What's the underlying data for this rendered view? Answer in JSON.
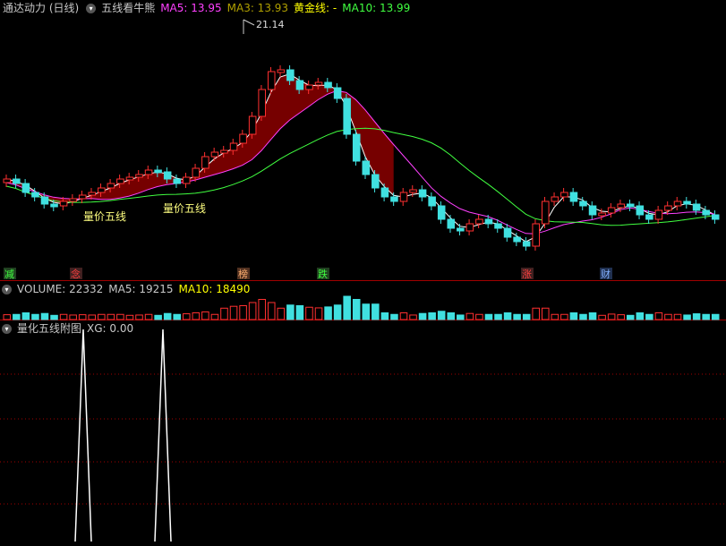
{
  "main_header": {
    "title": "通达动力 (日线)",
    "indicator_name": "五线看牛熊",
    "ma5": "MA5: 13.95",
    "ma3": "MA3: 13.93",
    "gold": "黄金线: -",
    "ma10": "MA10: 13.99",
    "colors": {
      "title": "#c8c8c8",
      "ma5": "#ff40ff",
      "ma3": "#b0a000",
      "gold": "#ffff00",
      "ma10": "#40ff40"
    }
  },
  "high_label": "21.14",
  "signals": [
    "量价五线",
    "量价五线"
  ],
  "event_markers": [
    {
      "text": "减",
      "color": "#40ff40",
      "bg": "#204020"
    },
    {
      "text": "念",
      "color": "#ff4040",
      "bg": "#402020"
    },
    {
      "text": "榜",
      "color": "#ffb070",
      "bg": "#503020"
    },
    {
      "text": "跌",
      "color": "#40ff40",
      "bg": "#204020"
    },
    {
      "text": "涨",
      "color": "#ff4040",
      "bg": "#402020"
    },
    {
      "text": "财",
      "color": "#80b0ff",
      "bg": "#203050"
    }
  ],
  "volume_header": {
    "volume": "VOLUME: 22332",
    "ma5": "MA5: 19215",
    "ma10": "MA10: 18490",
    "colors": {
      "volume": "#c8c8c8",
      "ma5": "#c8c8c8",
      "ma10": "#ffff00"
    }
  },
  "sub_header": {
    "name": "量化五线附图",
    "xg": "XG: 0.00"
  },
  "colors": {
    "up": "#ff3030",
    "down": "#40e0e0",
    "grid": "#a00000"
  }
}
